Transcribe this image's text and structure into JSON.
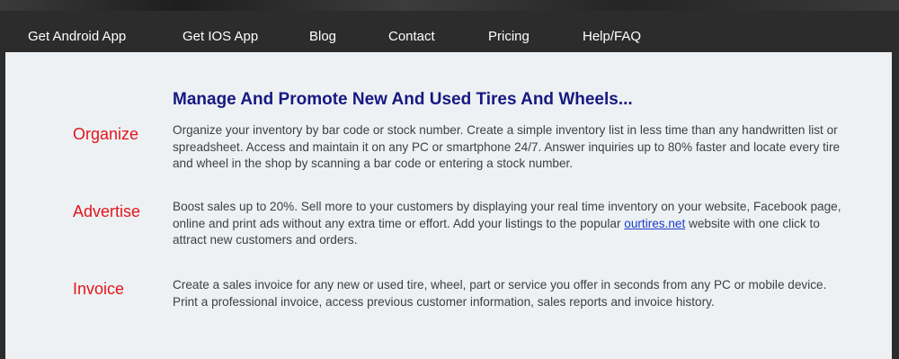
{
  "nav": {
    "items": [
      "Get Android App",
      "Get IOS App",
      "Blog",
      "Contact",
      "Pricing",
      "Help/FAQ"
    ]
  },
  "main": {
    "headline": "Manage And Promote New And Used Tires And Wheels...",
    "sections": [
      {
        "label": "Organize",
        "text": "Organize your inventory by bar code or stock number. Create a simple inventory list in less time than any handwritten list or spreadsheet. Access and maintain it on any PC or smartphone 24/7. Answer inquiries up to 80% faster and locate every tire and wheel in the shop by scanning a bar code or entering a stock number."
      },
      {
        "label": "Advertise",
        "text_before_link": "Boost sales up to 20%. Sell more to your customers by displaying your real time inventory on your website, Facebook page, online and print ads without any extra time or effort. Add your listings to the popular ",
        "link": "ourtires.net",
        "text_after_link": " website with one click to attract new customers and orders."
      },
      {
        "label": "Invoice",
        "text": "Create a sales invoice for any new or used tire, wheel, part or service you offer in seconds from any PC or mobile device. Print a professional invoice, access previous customer information, sales reports and invoice history."
      }
    ]
  },
  "colors": {
    "nav_bg": "#2b2c2b",
    "content_bg": "#eef1f4",
    "headline": "#151980",
    "section_label": "#e0161b",
    "body_text": "#3d3f42",
    "link": "#1a3dc8"
  }
}
